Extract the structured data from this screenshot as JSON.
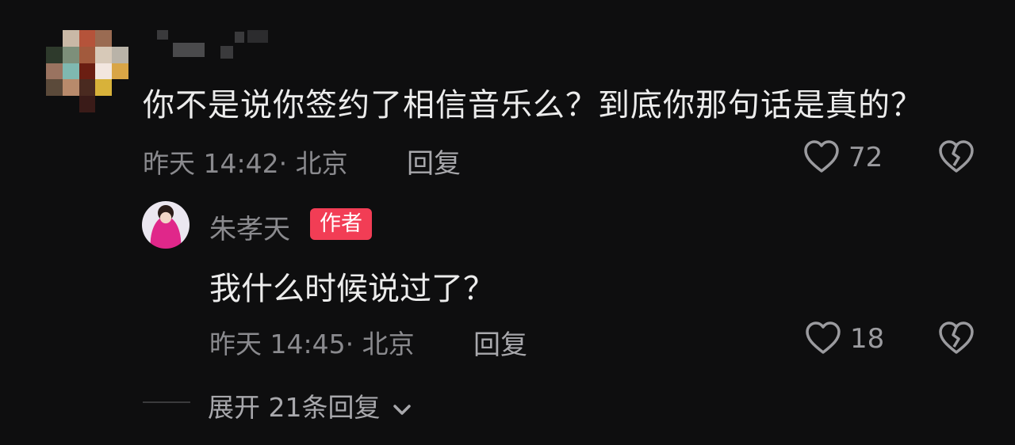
{
  "comment": {
    "text": "你不是说你签约了相信音乐么？到底你那句话是真的？",
    "meta": "昨天 14:42· 北京",
    "reply_label": "回复",
    "likes": "72"
  },
  "reply": {
    "author": "朱孝天",
    "badge": "作者",
    "text": "我什么时候说过了？",
    "meta": "昨天 14:45· 北京",
    "reply_label": "回复",
    "likes": "18"
  },
  "expand_label": "展开 21条回复",
  "colors": {
    "badge": "#f23d55",
    "background": "#0e0e0f"
  }
}
